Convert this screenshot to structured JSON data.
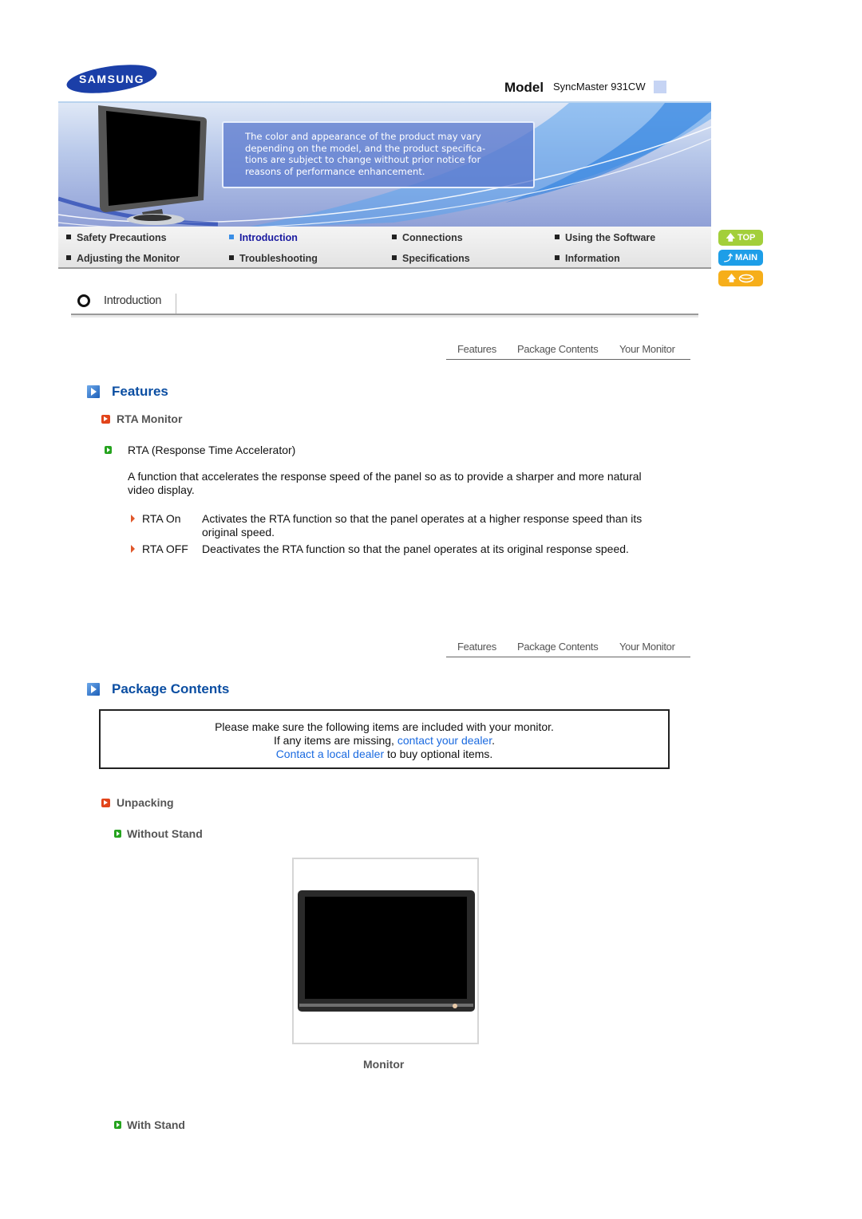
{
  "header": {
    "brand": "SAMSUNG",
    "model_label": "Model",
    "model_value": "SyncMaster 931CW",
    "notice": "The color and appearance of the product may vary\ndepending on the model, and the product specifica-\ntions are subject to change without prior notice for\nreasons of performance enhancement."
  },
  "menu": {
    "items": [
      {
        "label": "Safety Precautions",
        "active": false
      },
      {
        "label": "Introduction",
        "active": true
      },
      {
        "label": "Connections",
        "active": false
      },
      {
        "label": "Using the Software",
        "active": false
      },
      {
        "label": "Adjusting the Monitor",
        "active": false
      },
      {
        "label": "Troubleshooting",
        "active": false
      },
      {
        "label": "Specifications",
        "active": false
      },
      {
        "label": "Information",
        "active": false
      }
    ]
  },
  "side_buttons": {
    "top": "TOP",
    "main": "MAIN",
    "mail_icon": "envelope-icon"
  },
  "section": {
    "title": "Introduction"
  },
  "subnav": {
    "items": [
      "Features",
      "Package Contents",
      "Your Monitor"
    ]
  },
  "features": {
    "title": "Features",
    "subtitle": "RTA Monitor",
    "item_title": "RTA (Response Time Accelerator)",
    "description": "A function that accelerates the response speed of the panel so as to provide a sharper and more natural video display.",
    "options": [
      {
        "name": "RTA On",
        "desc": "Activates the RTA function so that the panel operates at a higher response speed than its original speed."
      },
      {
        "name": "RTA OFF",
        "desc": "Deactivates the RTA function so that the panel operates at its original response speed."
      }
    ]
  },
  "package": {
    "title": "Package Contents",
    "notice_line1": "Please make sure the following items are included with your monitor.",
    "notice_line2_prefix": "If any items are missing, ",
    "notice_line2_link": "contact your dealer",
    "notice_line2_suffix": ".",
    "notice_line3_link": "Contact a local dealer",
    "notice_line3_suffix": " to buy optional items.",
    "unpacking_title": "Unpacking",
    "without_stand": "Without Stand",
    "monitor_caption": "Monitor",
    "with_stand": "With Stand"
  },
  "colors": {
    "heading_blue": "#0b4ea2",
    "link_blue": "#1a6ae0",
    "active_menu": "#1a1aa0",
    "top_btn": "#a3cf3a",
    "main_btn": "#1d9ee8",
    "mail_btn": "#f6ae1a"
  }
}
